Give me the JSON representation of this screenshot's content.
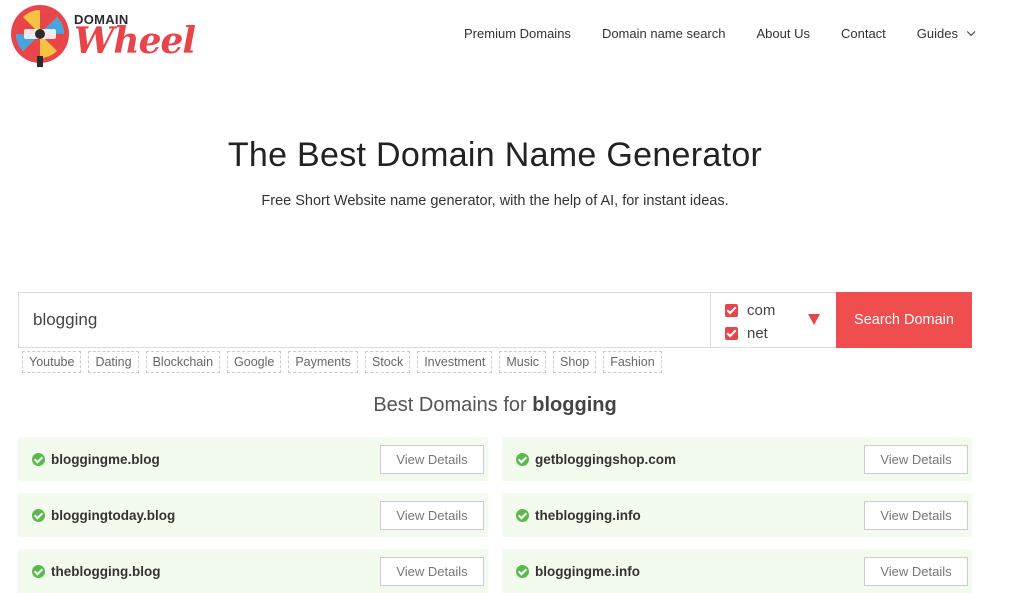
{
  "logo": {
    "top_text": "DOMAIN",
    "main_text": "Wheel"
  },
  "nav": {
    "items": [
      {
        "label": "Premium Domains"
      },
      {
        "label": "Domain name search"
      },
      {
        "label": "About Us"
      },
      {
        "label": "Contact"
      },
      {
        "label": "Guides"
      }
    ]
  },
  "hero": {
    "title": "The Best Domain Name Generator",
    "subtitle": "Free Short Website name generator, with the help of AI, for instant ideas."
  },
  "search": {
    "value": "blogging",
    "tlds": [
      {
        "label": "com",
        "checked": true
      },
      {
        "label": "net",
        "checked": true
      }
    ],
    "button_label": "Search Domain"
  },
  "tags": [
    "Youtube",
    "Dating",
    "Blockchain",
    "Google",
    "Payments",
    "Stock",
    "Investment",
    "Music",
    "Shop",
    "Fashion"
  ],
  "results": {
    "title_prefix": "Best Domains for ",
    "keyword": "blogging",
    "details_label": "View Details",
    "items": [
      "bloggingme.blog",
      "getbloggingshop.com",
      "bloggingtoday.blog",
      "theblogging.info",
      "theblogging.blog",
      "bloggingme.info"
    ]
  },
  "colors": {
    "brand": "#e8454a",
    "button": "#f04e4e",
    "result_bg": "#f3fbef",
    "ok": "#5cb84a"
  }
}
